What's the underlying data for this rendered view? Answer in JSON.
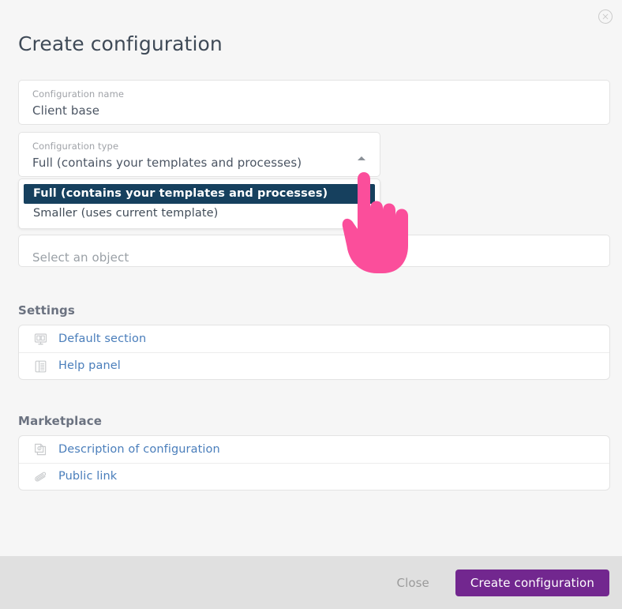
{
  "dialog": {
    "title": "Create configuration",
    "close_icon": "close-circle-icon"
  },
  "fields": {
    "name": {
      "label": "Configuration name",
      "value": "Client base"
    },
    "type": {
      "label": "Configuration type",
      "value": "Full (contains your templates and processes)",
      "caret_icon": "chevron-up-icon"
    },
    "object": {
      "placeholder": "Select an object"
    }
  },
  "dropdown": {
    "open": true,
    "options": [
      {
        "label": "Full (contains your templates and processes)",
        "selected": true
      },
      {
        "label": "Smaller (uses current template)",
        "selected": false
      }
    ]
  },
  "sections": [
    {
      "title": "Settings",
      "items": [
        {
          "label": "Default section",
          "icon": "display-panels-icon"
        },
        {
          "label": "Help panel",
          "icon": "side-panel-icon"
        }
      ]
    },
    {
      "title": "Marketplace",
      "items": [
        {
          "label": "Description of configuration",
          "icon": "document-info-icon"
        },
        {
          "label": "Public link",
          "icon": "paperclip-icon"
        }
      ]
    }
  ],
  "footer": {
    "close_label": "Close",
    "create_label": "Create configuration"
  },
  "cursor": {
    "icon": "pointing-hand-cursor"
  },
  "colors": {
    "page_background": "#f6f6f6",
    "footer_background": "#e0e0e0",
    "card_background": "#ffffff",
    "border": "#e3e3e3",
    "title_text": "#3f4a57",
    "section_heading": "#6b7280",
    "link_text": "#4a7ebb",
    "muted_text": "#a0a3a8",
    "dropdown_selected_background": "#16405e",
    "primary_button": "#72278f",
    "cursor_pink": "#fb4e9b"
  }
}
